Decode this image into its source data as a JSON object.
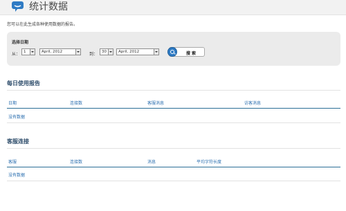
{
  "header": {
    "title": "统计数据",
    "icon": "speech-bubble-icon"
  },
  "description": "您可以在此生成各种使用数据的报告。",
  "filter": {
    "title": "选择日期",
    "from_label": "从：",
    "from_day": "1",
    "from_month": "April, 2012",
    "to_label": "到：",
    "to_day": "30",
    "to_month": "April, 2012",
    "search_label": "搜 索"
  },
  "daily_usage": {
    "title": "每日使用报告",
    "columns": [
      "日期",
      "连接数",
      "客服消息",
      "访客消息"
    ],
    "empty_text": "没有数据"
  },
  "agent_connections": {
    "title": "客服连接",
    "columns": [
      "客服",
      "连接数",
      "消息",
      "平均字符长度"
    ],
    "empty_text": "没有数据"
  },
  "colors": {
    "accent": "#2b6fb0",
    "section_title": "#2e4d6b",
    "panel_bg": "#ebebeb"
  }
}
